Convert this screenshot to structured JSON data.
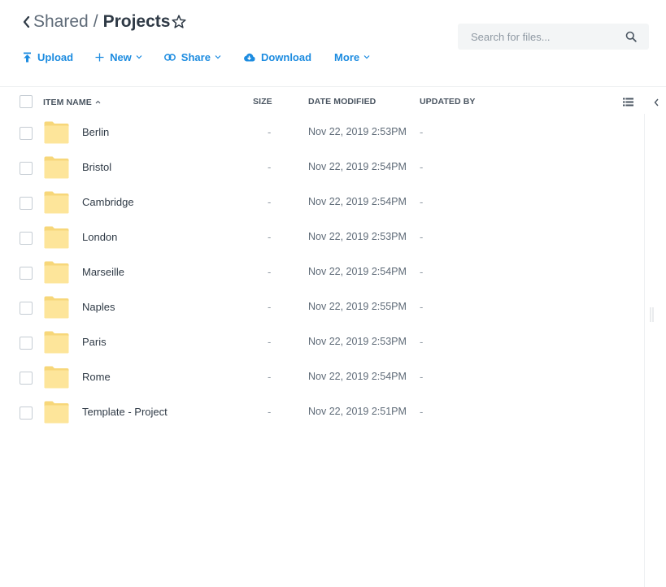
{
  "header": {
    "parent": "Shared",
    "separator": "/",
    "current": "Projects"
  },
  "search": {
    "placeholder": "Search for files..."
  },
  "toolbar": {
    "upload": "Upload",
    "new": "New",
    "share": "Share",
    "download": "Download",
    "more": "More"
  },
  "table": {
    "columns": {
      "name": "ITEM NAME",
      "size": "SIZE",
      "date": "DATE MODIFIED",
      "by": "UPDATED BY"
    },
    "rows": [
      {
        "name": "Berlin",
        "size": "-",
        "date": "Nov 22, 2019 2:53PM",
        "by": "-"
      },
      {
        "name": "Bristol",
        "size": "-",
        "date": "Nov 22, 2019 2:54PM",
        "by": "-"
      },
      {
        "name": "Cambridge",
        "size": "-",
        "date": "Nov 22, 2019 2:54PM",
        "by": "-"
      },
      {
        "name": "London",
        "size": "-",
        "date": "Nov 22, 2019 2:53PM",
        "by": "-"
      },
      {
        "name": "Marseille",
        "size": "-",
        "date": "Nov 22, 2019 2:54PM",
        "by": "-"
      },
      {
        "name": "Naples",
        "size": "-",
        "date": "Nov 22, 2019 2:55PM",
        "by": "-"
      },
      {
        "name": "Paris",
        "size": "-",
        "date": "Nov 22, 2019 2:53PM",
        "by": "-"
      },
      {
        "name": "Rome",
        "size": "-",
        "date": "Nov 22, 2019 2:54PM",
        "by": "-"
      },
      {
        "name": "Template - Project",
        "size": "-",
        "date": "Nov 22, 2019 2:51PM",
        "by": "-"
      }
    ]
  },
  "icons": {
    "back": "chevron-left-icon",
    "favorite": "star-outline-icon",
    "search": "magnifier-icon",
    "upload": "arrow-up-icon",
    "new": "plus-icon",
    "share": "link-icon",
    "download": "cloud-download-icon",
    "folder": "folder-icon",
    "view": "list-view-icon",
    "panel": "chevron-left-icon"
  },
  "colors": {
    "accent": "#1d8ce0",
    "folder": "#fde59a",
    "text": "#2f3a46",
    "muted": "#8f99a3"
  }
}
